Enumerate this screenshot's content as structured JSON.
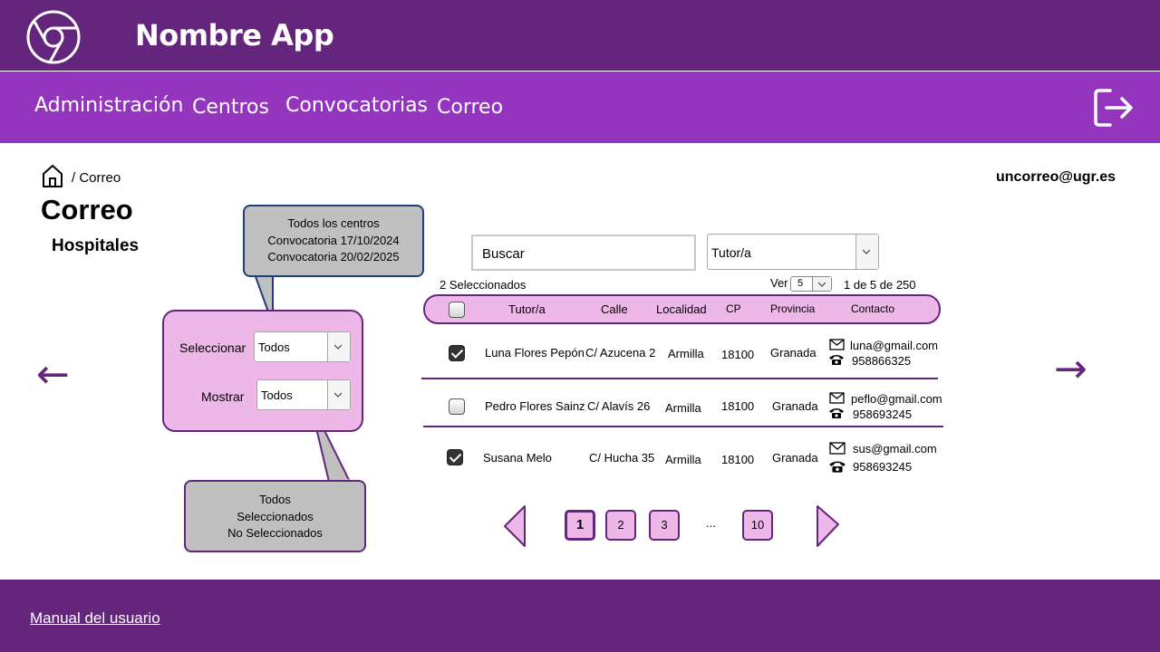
{
  "app": {
    "title": "Nombre App"
  },
  "nav": {
    "items": [
      "Administración",
      "Centros",
      "Convocatorias",
      "Correo"
    ]
  },
  "breadcrumb": {
    "text": "/ Correo"
  },
  "user": {
    "email": "uncorreo@ugr.es"
  },
  "page": {
    "title": "Correo",
    "subtitle": "Hospitales"
  },
  "filters": {
    "select_label": "Seleccionar",
    "select_value": "Todos",
    "show_label": "Mostrar",
    "show_value": "Todos",
    "select_options": [
      "Todos los centros",
      "Convocatoria 17/10/2024",
      "Convocatoria 20/02/2025"
    ],
    "show_options": [
      "Todos",
      "Seleccionados",
      "No Seleccionados"
    ]
  },
  "search": {
    "placeholder": "Buscar"
  },
  "tutor_filter": {
    "value": "Tutor/a"
  },
  "table_info": {
    "selected": "2 Seleccionados",
    "ver_label": "Ver",
    "ver_value": "5",
    "range": "1 de 5 de 250"
  },
  "table": {
    "headers": [
      "Tutor/a",
      "Calle",
      "Localidad",
      "CP",
      "Provincia",
      "Contacto"
    ],
    "rows": [
      {
        "checked": true,
        "tutor": "Luna Flores Pepón",
        "calle": "C/ Azucena 2",
        "localidad": "Armilla",
        "cp": "18100",
        "provincia": "Granada",
        "email": "luna@gmail.com",
        "phone": "958866325"
      },
      {
        "checked": false,
        "tutor": "Pedro Flores Sainz",
        "calle": "C/ Alavís 26",
        "localidad": "Armilla",
        "cp": "18100",
        "provincia": "Granada",
        "email": "peflo@gmail.com",
        "phone": "958693245"
      },
      {
        "checked": true,
        "tutor": "Susana Melo",
        "calle": "C/ Hucha 35",
        "localidad": "Armilla",
        "cp": "18100",
        "provincia": "Granada",
        "email": "sus@gmail.com",
        "phone": "958693245"
      }
    ]
  },
  "pagination": {
    "pages": [
      "1",
      "2",
      "3",
      "10"
    ],
    "ellipsis": "...",
    "current": "1"
  },
  "arrows": {
    "left": "←",
    "right": "→"
  },
  "footer": {
    "manual": "Manual del usuario"
  },
  "colors": {
    "header": "#63267c",
    "nav": "#9336bd",
    "panel": "#edb8e8",
    "callout": "#c0c0c0"
  },
  "icons": [
    "chrome-logo-icon",
    "logout-icon",
    "home-icon",
    "mail-icon",
    "phone-icon",
    "chevron-down-icon",
    "arrow-left-icon",
    "arrow-right-icon"
  ]
}
